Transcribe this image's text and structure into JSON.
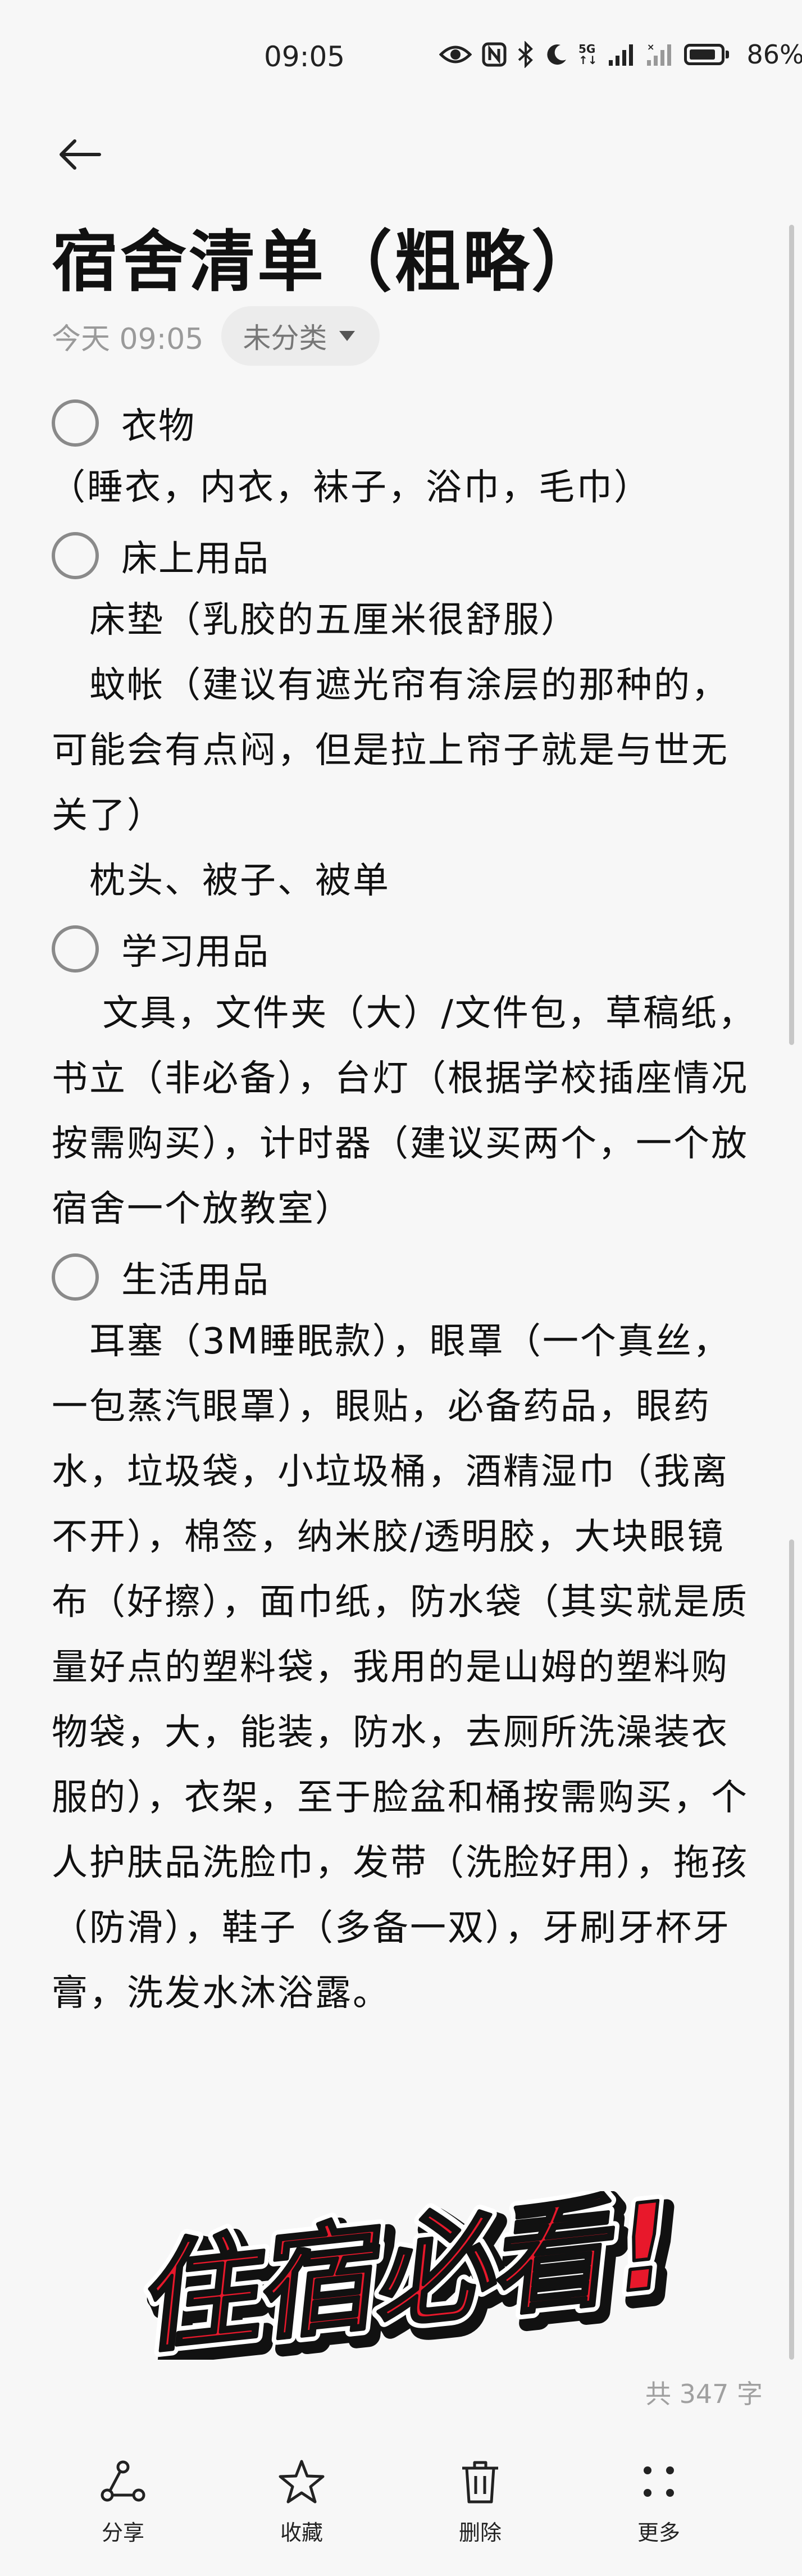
{
  "status_bar": {
    "time": "09:05",
    "network": "5G",
    "battery_percent": "86%",
    "battery_level": 0.86,
    "icons": [
      "eye-icon",
      "nfc-icon",
      "bluetooth-icon",
      "moon-icon",
      "signal-icon",
      "signal-icon",
      "battery-icon"
    ]
  },
  "note": {
    "title": "宿舍清单（粗略）",
    "time": "今天 09:05",
    "category": "未分类",
    "sections": [
      {
        "label": "衣物",
        "lines": [
          "（睡衣，内衣，袜子，浴巾，毛巾）"
        ]
      },
      {
        "label": "床上用品",
        "lines": [
          "　床垫（乳胶的五厘米很舒服）",
          "　蚊帐（建议有遮光帘有涂层的那种的，可能会有点闷，但是拉上帘子就是与世无关了）",
          "　枕头、被子、被单"
        ]
      },
      {
        "label": "学习用品",
        "lines": [
          "　 文具，文件夹（大）/文件包，草稿纸，书立（非必备），台灯（根据学校插座情况按需购买），计时器（建议买两个，一个放宿舍一个放教室）"
        ]
      },
      {
        "label": "生活用品",
        "lines": [
          "　耳塞（3M睡眠款），眼罩（一个真丝，一包蒸汽眼罩），眼贴，必备药品，眼药水，垃圾袋，小垃圾桶，酒精湿巾（我离不开），棉签，纳米胶/透明胶，大块眼镜布（好擦），面巾纸，防水袋（其实就是质量好点的塑料袋，我用的是山姆的塑料购物袋，大，能装，防水，去厕所洗澡装衣服的），衣架，至于脸盆和桶按需购买，个人护肤品洗脸巾，发带（洗脸好用），拖孩（防滑），鞋子（多备一双），牙刷牙杯牙膏，洗发水沐浴露。"
        ]
      }
    ],
    "sticker_text": "住宿必看!",
    "word_count": "共 347 字"
  },
  "bottom_bar": {
    "share": "分享",
    "favorite": "收藏",
    "delete": "删除",
    "more": "更多"
  },
  "colors": {
    "background": "#f7f7f7",
    "sticker_red": "#e8182b",
    "checkbox_border": "#8a8a8a"
  }
}
